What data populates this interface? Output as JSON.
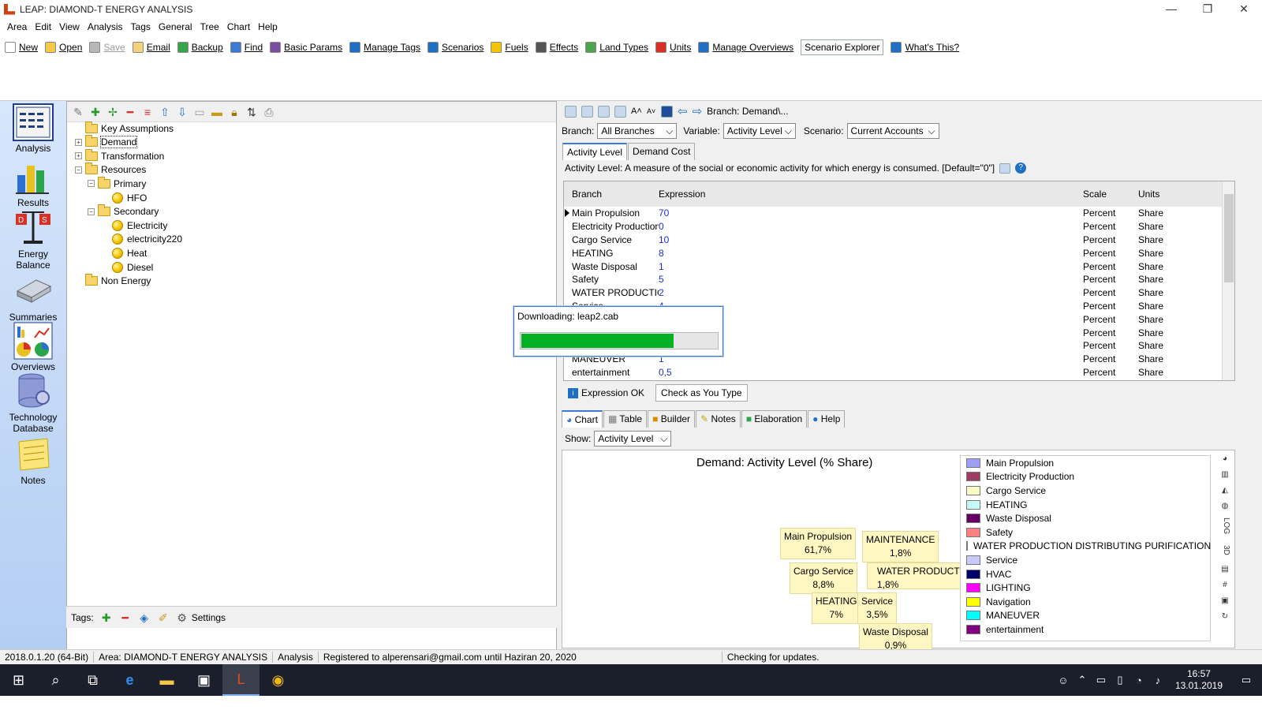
{
  "window": {
    "title": "LEAP: DIAMOND-T ENERGY ANALYSIS",
    "min": "—",
    "max": "❐",
    "close": "✕"
  },
  "menu": [
    "Area",
    "Edit",
    "View",
    "Analysis",
    "Tags",
    "General",
    "Tree",
    "Chart",
    "Help"
  ],
  "toolbar": [
    {
      "label": "New",
      "icon": "new-doc-icon",
      "color": "#ffffff"
    },
    {
      "label": "Open",
      "icon": "open-folder-icon",
      "color": "#f7c948"
    },
    {
      "label": "Save",
      "icon": "save-icon",
      "color": "#b8b8b8",
      "disabled": true
    },
    {
      "label": "Email",
      "icon": "email-icon",
      "color": "#f3d27a"
    },
    {
      "label": "Backup",
      "icon": "backup-icon",
      "color": "#37a54a"
    },
    {
      "label": "Find",
      "icon": "find-icon",
      "color": "#3a7bd5"
    },
    {
      "label": "Basic Params",
      "icon": "checklist-icon",
      "color": "#7a4fa3"
    },
    {
      "label": "Manage Tags",
      "icon": "tag-icon",
      "color": "#1f6fc4"
    },
    {
      "label": "Scenarios",
      "icon": "scenarios-icon",
      "color": "#1f6fc4"
    },
    {
      "label": "Fuels",
      "icon": "fuel-icon",
      "color": "#f5c400"
    },
    {
      "label": "Effects",
      "icon": "effects-icon",
      "color": "#555555"
    },
    {
      "label": "Land Types",
      "icon": "tree-icon",
      "color": "#4aa64a"
    },
    {
      "label": "Units",
      "icon": "units-icon",
      "color": "#d93025"
    },
    {
      "label": "Manage Overviews",
      "icon": "overview-icon",
      "color": "#1f6fc4"
    },
    {
      "label": "Scenario Explorer",
      "icon": "",
      "color": "",
      "boxed": true
    },
    {
      "label": "What's This?",
      "icon": "help-icon",
      "color": "#1f6fc4"
    }
  ],
  "sidebar": [
    {
      "label": "Analysis",
      "icon": "analysis-icon"
    },
    {
      "label": "Results",
      "icon": "results-icon"
    },
    {
      "label": "Energy Balance",
      "icon": "energy-balance-icon"
    },
    {
      "label": "Summaries",
      "icon": "summaries-icon"
    },
    {
      "label": "Overviews",
      "icon": "overviews-icon"
    },
    {
      "label": "Technology Database",
      "icon": "technology-database-icon"
    },
    {
      "label": "Notes",
      "icon": "notes-icon"
    }
  ],
  "tree": [
    {
      "label": "Key Assumptions",
      "level": 0,
      "kind": "folder",
      "exp": ""
    },
    {
      "label": "Demand",
      "level": 0,
      "kind": "folder",
      "exp": "+",
      "selected": true
    },
    {
      "label": "Transformation",
      "level": 0,
      "kind": "folder",
      "exp": "+"
    },
    {
      "label": "Resources",
      "level": 0,
      "kind": "folder",
      "exp": "−"
    },
    {
      "label": "Primary",
      "level": 1,
      "kind": "folder",
      "exp": "−"
    },
    {
      "label": "HFO",
      "level": 2,
      "kind": "fuel",
      "exp": ""
    },
    {
      "label": "Secondary",
      "level": 1,
      "kind": "folder",
      "exp": "−"
    },
    {
      "label": "Electricity",
      "level": 2,
      "kind": "fuel",
      "exp": ""
    },
    {
      "label": "electricity220",
      "level": 2,
      "kind": "fuel",
      "exp": ""
    },
    {
      "label": "Heat",
      "level": 2,
      "kind": "fuel",
      "exp": ""
    },
    {
      "label": "Diesel",
      "level": 2,
      "kind": "fuel",
      "exp": ""
    },
    {
      "label": "Non Energy",
      "level": 0,
      "kind": "folder",
      "exp": ""
    }
  ],
  "tags_bar": {
    "label": "Tags:",
    "settings": "Settings"
  },
  "branch_path": "Branch: Demand\\...",
  "selectors": {
    "branch_label": "Branch:",
    "branch_value": "All Branches",
    "variable_label": "Variable:",
    "variable_value": "Activity Level",
    "scenario_label": "Scenario:",
    "scenario_value": "Current Accounts"
  },
  "var_tabs": [
    "Activity Level",
    "Demand Cost"
  ],
  "description": "Activity Level: A measure of the social or economic activity for which energy is consumed. [Default=\"0\"]",
  "grid": {
    "headers": {
      "branch": "Branch",
      "expression": "Expression",
      "scale": "Scale",
      "units": "Units"
    },
    "rows": [
      {
        "branch": "Main Propulsion",
        "expr": "70",
        "scale": "Percent",
        "units": "Share"
      },
      {
        "branch": "Electricity Production",
        "expr": "0",
        "scale": "Percent",
        "units": "Share"
      },
      {
        "branch": "Cargo Service",
        "expr": "10",
        "scale": "Percent",
        "units": "Share"
      },
      {
        "branch": "HEATING",
        "expr": "8",
        "scale": "Percent",
        "units": "Share"
      },
      {
        "branch": "Waste Disposal",
        "expr": "1",
        "scale": "Percent",
        "units": "Share"
      },
      {
        "branch": "Safety",
        "expr": "5",
        "scale": "Percent",
        "units": "Share"
      },
      {
        "branch": "WATER PRODUCTION",
        "expr": "2",
        "scale": "Percent",
        "units": "Share"
      },
      {
        "branch": "Service",
        "expr": "4",
        "scale": "Percent",
        "units": "Share"
      },
      {
        "branch": "",
        "expr": "",
        "scale": "Percent",
        "units": "Share"
      },
      {
        "branch": "",
        "expr": "",
        "scale": "Percent",
        "units": "Share"
      },
      {
        "branch": "",
        "expr": "",
        "scale": "Percent",
        "units": "Share"
      },
      {
        "branch": "MANEUVER",
        "expr": "1",
        "scale": "Percent",
        "units": "Share"
      },
      {
        "branch": "entertainment",
        "expr": "0,5",
        "scale": "Percent",
        "units": "Share"
      }
    ]
  },
  "status_buttons": {
    "expression_ok": "Expression OK",
    "check": "Check as You Type"
  },
  "bottom_tabs": [
    "Chart",
    "Table",
    "Builder",
    "Notes",
    "Elaboration",
    "Help"
  ],
  "show": {
    "label": "Show:",
    "value": "Activity Level"
  },
  "chart_data": {
    "type": "pie",
    "title": "Demand: Activity Level (% Share)",
    "legend": [
      {
        "name": "Main Propulsion",
        "color": "#9f9ff5"
      },
      {
        "name": "Electricity Production",
        "color": "#9c3d63"
      },
      {
        "name": "Cargo Service",
        "color": "#fbfbc6"
      },
      {
        "name": "HEATING",
        "color": "#c8fafa"
      },
      {
        "name": "Waste Disposal",
        "color": "#660066"
      },
      {
        "name": "Safety",
        "color": "#fb8080"
      },
      {
        "name": "WATER PRODUCTION DISTRIBUTING PURIFICATION",
        "color": "#0063c7"
      },
      {
        "name": "Service",
        "color": "#c9c9fc"
      },
      {
        "name": "HVAC",
        "color": "#00006b"
      },
      {
        "name": "LIGHTING",
        "color": "#ff00ff"
      },
      {
        "name": "Navigation",
        "color": "#ffff00"
      },
      {
        "name": "MANEUVER",
        "color": "#00ffff"
      },
      {
        "name": "entertainment",
        "color": "#800080"
      }
    ],
    "labels": [
      {
        "name": "Main Propulsion",
        "value": "61,7%"
      },
      {
        "name": "MAINTENANCE",
        "value": "1,8%"
      },
      {
        "name": "Cargo Service",
        "value": "8,8%"
      },
      {
        "name": "WATER PRODUCTION DISTRIBUTING PURIFICATION",
        "value": "1,8%"
      },
      {
        "name": "HEATING",
        "value": "7%"
      },
      {
        "name": "Service",
        "value": "3,5%"
      },
      {
        "name": "Waste Disposal",
        "value": "0,9%"
      }
    ],
    "legend_position": "right"
  },
  "chart_side_icons": [
    "pie-icon",
    "bar-icon",
    "area-icon",
    "globe-icon",
    "LOG",
    "3D",
    "table-icon",
    "grid-icon",
    "num-icon",
    "reset-icon"
  ],
  "download": {
    "text": "Downloading: leap2.cab",
    "progress": 0.77,
    "fill_color": "#06b025"
  },
  "statusbar": [
    "2018.0.1.20 (64-Bit)",
    "Area: DIAMOND-T ENERGY ANALYSIS",
    "Analysis",
    "Registered to alperensari@gmail.com until Haziran 20, 2020",
    "Checking for updates."
  ],
  "taskbar": {
    "time": "16:57",
    "date": "13.01.2019"
  }
}
